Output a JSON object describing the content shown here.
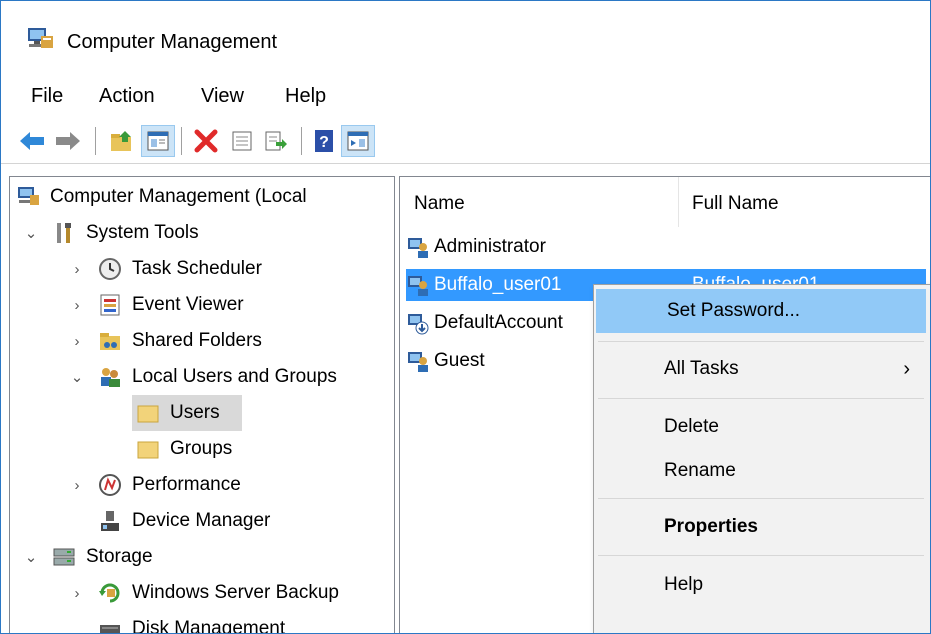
{
  "window": {
    "title": "Computer Management"
  },
  "menu": [
    "File",
    "Action",
    "View",
    "Help"
  ],
  "toolbar": [
    "back-arrow-icon",
    "forward-arrow-icon",
    "up-folder-icon",
    "show-hide-tree-icon",
    "delete-icon",
    "properties-icon",
    "export-list-icon",
    "help-icon",
    "show-action-pane-icon"
  ],
  "tree": {
    "root": "Computer Management (Local",
    "system_tools": "System Tools",
    "task_scheduler": "Task Scheduler",
    "event_viewer": "Event Viewer",
    "shared_folders": "Shared Folders",
    "local_users_groups": "Local Users and Groups",
    "users": "Users",
    "groups": "Groups",
    "performance": "Performance",
    "device_manager": "Device Manager",
    "storage": "Storage",
    "wsb": "Windows Server Backup",
    "disk_mgmt": "Disk Management"
  },
  "list": {
    "columns": [
      "Name",
      "Full Name"
    ],
    "rows": [
      {
        "name": "Administrator",
        "full": ""
      },
      {
        "name": "Buffalo_user01",
        "full": "Buffalo_user01"
      },
      {
        "name": "DefaultAccount",
        "full": ""
      },
      {
        "name": "Guest",
        "full": ""
      }
    ]
  },
  "context_menu": {
    "set_password": "Set Password...",
    "all_tasks": "All Tasks",
    "delete": "Delete",
    "rename": "Rename",
    "properties": "Properties",
    "help": "Help"
  },
  "colors": {
    "selection": "#3399ff",
    "menu_highlight": "#91c9f7",
    "accent": "#2b78c5"
  }
}
